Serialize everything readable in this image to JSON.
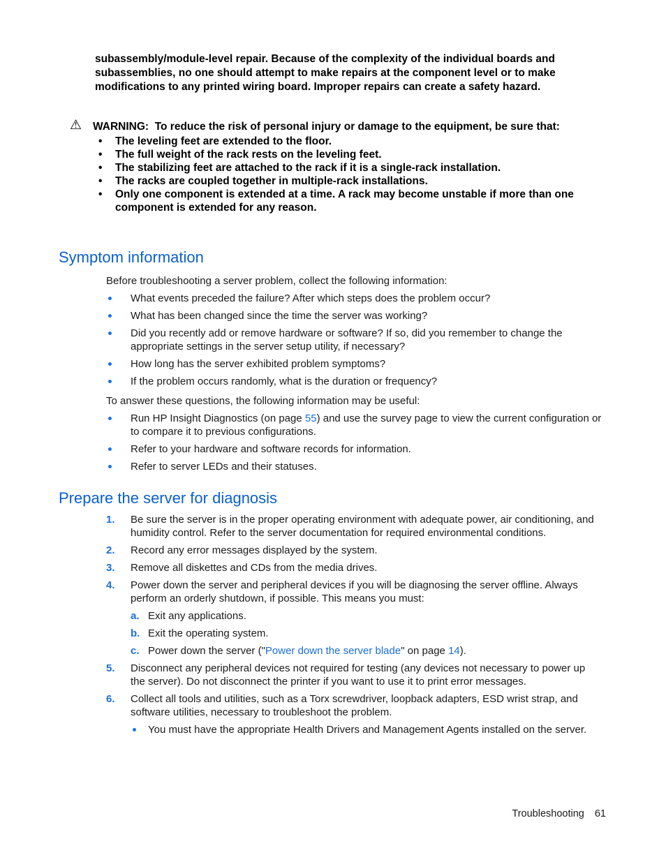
{
  "intro_text": "subassembly/module-level repair. Because of the complexity of the individual boards and subassemblies, no one should attempt to make repairs at the component level or to make modifications to any printed wiring board. Improper repairs can create a safety hazard.",
  "warning": {
    "icon": "warning-triangle-icon",
    "label": "WARNING:",
    "text": "To reduce the risk of personal injury or damage to the equipment, be sure that:",
    "items": [
      "The leveling feet are extended to the floor.",
      "The full weight of the rack rests on the leveling feet.",
      "The stabilizing feet are attached to the rack if it is a single-rack installation.",
      "The racks are coupled together in multiple-rack installations.",
      "Only one component is extended at a time. A rack may become unstable if more than one component is extended for any reason."
    ]
  },
  "symptom": {
    "heading": "Symptom information",
    "intro": "Before troubleshooting a server problem, collect the following information:",
    "questions": [
      "What events preceded the failure? After which steps does the problem occur?",
      "What has been changed since the time the server was working?",
      "Did you recently add or remove hardware or software? If so, did you remember to change the appropriate settings in the server setup utility, if necessary?",
      "How long has the server exhibited problem symptoms?",
      "If the problem occurs randomly, what is the duration or frequency?"
    ],
    "intro2": "To answer these questions, the following information may be useful:",
    "useful": {
      "item1_pre": "Run HP Insight Diagnostics (on page ",
      "item1_link": "55",
      "item1_post": ") and use the survey page to view the current configuration or to compare it to previous configurations.",
      "item2": "Refer to your hardware and software records for information.",
      "item3": "Refer to server LEDs and their statuses."
    }
  },
  "prepare": {
    "heading": "Prepare the server for diagnosis",
    "steps": [
      {
        "num": "1.",
        "text": "Be sure the server is in the proper operating environment with adequate power, air conditioning, and humidity control. Refer to the server documentation for required environmental conditions."
      },
      {
        "num": "2.",
        "text": "Record any error messages displayed by the system."
      },
      {
        "num": "3.",
        "text": "Remove all diskettes and CDs from the media drives."
      },
      {
        "num": "4.",
        "text": "Power down the server and peripheral devices if you will be diagnosing the server offline. Always perform an orderly shutdown, if possible. This means you must:"
      },
      {
        "num": "5.",
        "text": "Disconnect any peripheral devices not required for testing (any devices not necessary to power up the server). Do not disconnect the printer if you want to use it to print error messages."
      },
      {
        "num": "6.",
        "text": "Collect all tools and utilities, such as a Torx screwdriver, loopback adapters, ESD wrist strap, and software utilities, necessary to troubleshoot the problem."
      }
    ],
    "substeps": [
      {
        "num": "a.",
        "text": "Exit any applications."
      },
      {
        "num": "b.",
        "text": "Exit the operating system."
      },
      {
        "num": "c.",
        "pre": "Power down the server (\"",
        "link": "Power down the server blade",
        "mid": "\" on page ",
        "page_link": "14",
        "post": ")."
      }
    ],
    "step6_bullet": "You must have the appropriate Health Drivers and Management Agents installed on the server."
  },
  "footer": {
    "section": "Troubleshooting",
    "page": "61"
  },
  "colors": {
    "heading": "#0a5fd1",
    "link": "#1a6fd6",
    "bullet": "#1a73e8"
  }
}
